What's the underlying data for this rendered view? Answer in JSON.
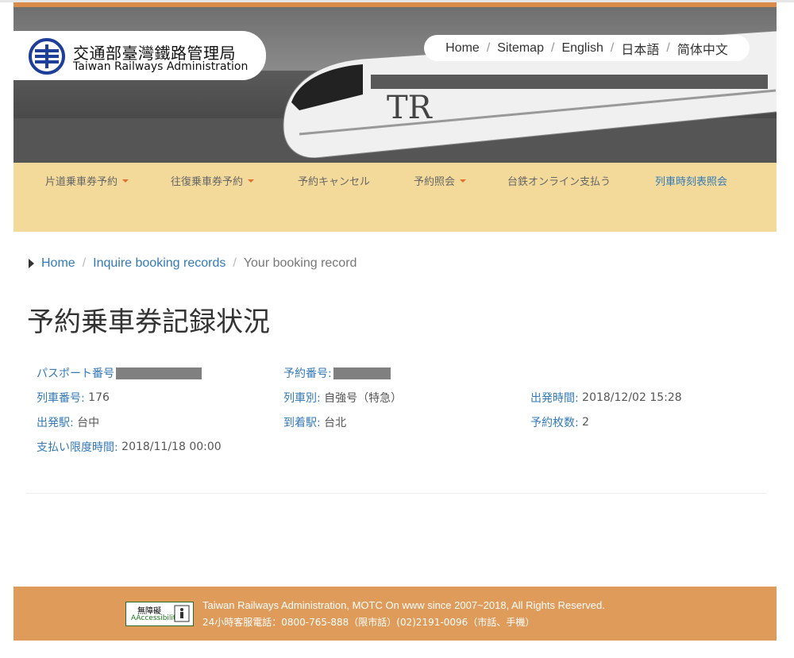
{
  "header": {
    "logo_zh": "交通部臺灣鐵路管理局",
    "logo_en": "Taiwan Railways Administration",
    "top_links": [
      "Home",
      "Sitemap",
      "English",
      "日本語",
      "简体中文"
    ]
  },
  "nav": {
    "items": [
      {
        "label": "片道乗車券予約",
        "dropdown": true
      },
      {
        "label": "往復乗車券予約",
        "dropdown": true
      },
      {
        "label": "予約キャンセル",
        "dropdown": false
      },
      {
        "label": "予約照会",
        "dropdown": true
      },
      {
        "label": "台鉄オンライン支払う",
        "dropdown": false
      },
      {
        "label": "列車時刻表照会",
        "dropdown": false
      }
    ]
  },
  "breadcrumb": {
    "home": "Home",
    "inquire": "Inquire booking records",
    "current": "Your booking record"
  },
  "page": {
    "title": "予約乗車券記録状況"
  },
  "record": {
    "passport_label": "パスポート番号",
    "booking_no_label": "予約番号:",
    "train_no_label": "列車番号:",
    "train_no": "176",
    "train_type_label": "列車別:",
    "train_type": "自強号（特急）",
    "departure_time_label": "出発時間:",
    "departure_time": "2018/12/02 15:28",
    "from_label": "出発駅:",
    "from": "台中",
    "to_label": "到着駅:",
    "to": "台北",
    "tickets_label": "予約枚数:",
    "tickets": "2",
    "deadline_label": "支払い限度時間:",
    "deadline": "2018/11/18 00:00"
  },
  "footer": {
    "badge_top": "無障礙",
    "badge_bottom": "AAccessibility",
    "line1": "Taiwan Railways Administration, MOTC On www since 2007~2018, All Rights Reserved.",
    "line2": "24小時客服電話：0800-765-888（限市話）(02)2191-0096（市話、手機）"
  },
  "colors": {
    "accent_orange": "#df9b59",
    "nav_bg": "#f3da9a",
    "link_blue": "#337ab7"
  }
}
